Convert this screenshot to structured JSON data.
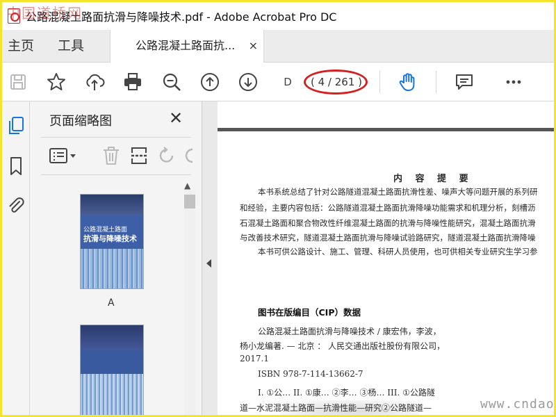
{
  "window": {
    "title": "公路混凝土路面抗滑与降噪技术.pdf - Adobe Acrobat Pro DC"
  },
  "watermarks": {
    "top_left": "中国道桥网",
    "bottom_right": "www.cndao.com"
  },
  "tabs": {
    "home": "主页",
    "tools": "工具",
    "document": "公路混凝土路面抗...",
    "close": "×"
  },
  "toolbar": {
    "icons": [
      "save-icon",
      "star-icon",
      "cloud-upload-icon",
      "print-icon",
      "zoom-icon",
      "page-up-icon",
      "page-down-icon",
      "hand-icon",
      "comment-icon",
      "more-icon"
    ],
    "page_input": "D",
    "page_count": "( 4 / 261 )",
    "annotation_color": "#d42020",
    "hand_color": "#1473e6"
  },
  "thumbnails_panel": {
    "title": "页面缩略图",
    "close": "✕",
    "thumbnails": [
      {
        "label": "A",
        "cover_line1": "公路混凝土路面",
        "cover_line2": "抗滑与降噪技术"
      },
      {
        "label": ""
      }
    ]
  },
  "document_page": {
    "heading": "内 容 提 要",
    "summary_lines": [
      "本书系统总结了针对公路隧道混凝土路面抗滑性差、噪声大等问题开展的系列研",
      "和经验，主要内容包括：公路隧道混凝土路面抗滑降噪功能需求和机理分析，刻槽沥",
      "石混凝土路面和聚合物改性纤维混凝土路面的抗滑与降噪性能研究，混凝土路面抗滑",
      "与改善技术研究，隧道混凝土路面抗滑与降噪试验路研究，隧道混凝土路面抗滑降噪",
      "本书可供公路设计、施工、管理、科研人员使用，也可供相关专业研究生学习参"
    ],
    "cip_title": "图书在版编目（CIP）数据",
    "cip_lines": [
      "公路混凝土路面抗滑与降噪技术 / 康宏伟，李波，",
      "杨小龙编著. — 北京 ： 人民交通出版社股份有限公司，",
      "2017.1",
      "ISBN 978-7-114-13662-7",
      "I. ①公… II. ①康… ②李… ③杨… III. ①公路隧",
      "道—水泥混凝土路面—抗滑性能—研究②公路隧道—"
    ]
  }
}
